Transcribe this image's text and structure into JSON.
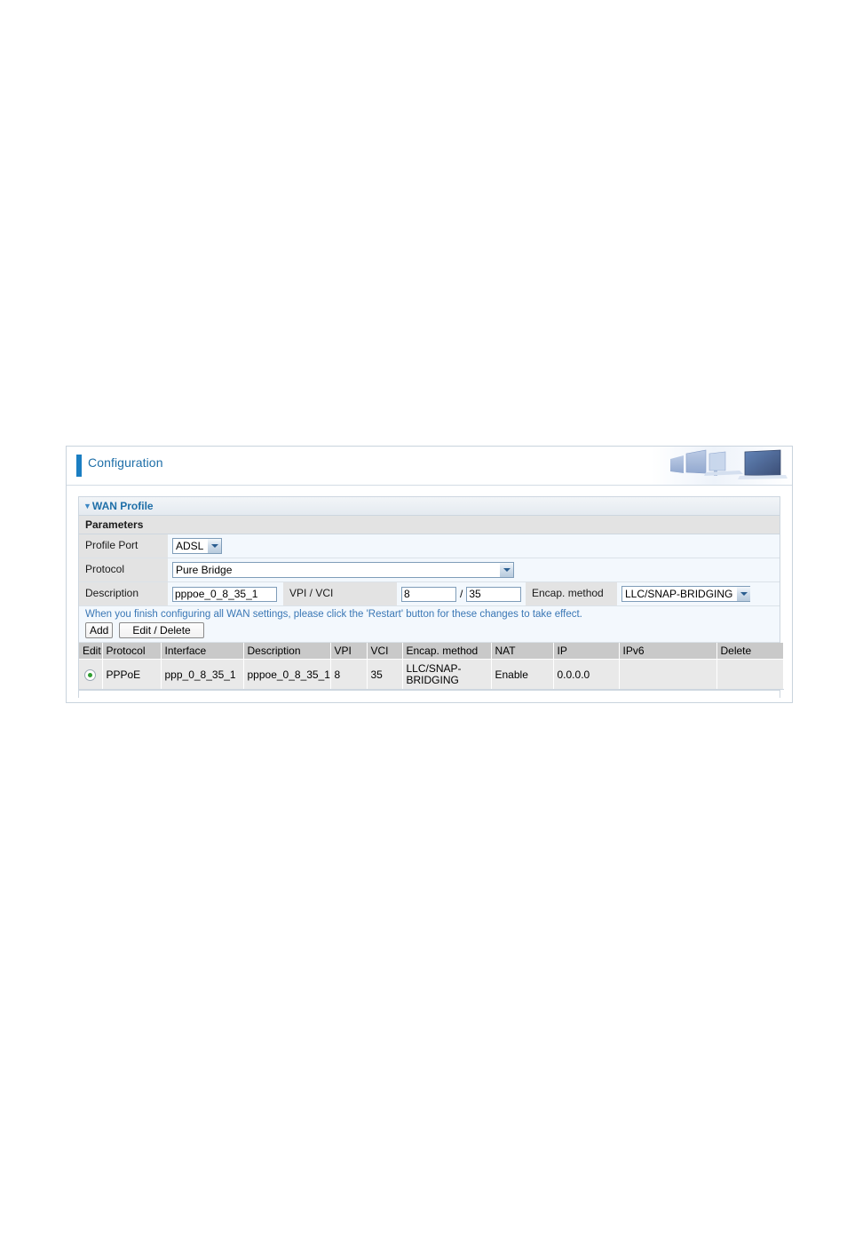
{
  "header": {
    "title": "Configuration",
    "banner_icon": "office-monitors-banner"
  },
  "section": {
    "title": "WAN Profile",
    "collapse_icon": "triangle-down-icon",
    "subtitle": "Parameters"
  },
  "form": {
    "profile_port": {
      "label": "Profile Port",
      "value": "ADSL",
      "options": [
        "ADSL"
      ]
    },
    "protocol": {
      "label": "Protocol",
      "value": "Pure Bridge",
      "options": [
        "Pure Bridge"
      ]
    },
    "description": {
      "label": "Description",
      "value": "pppoe_0_8_35_1"
    },
    "vpi_vci": {
      "label": "VPI / VCI",
      "vpi": "8",
      "separator": "/",
      "vci": "35"
    },
    "encap_method": {
      "label": "Encap. method",
      "value": "LLC/SNAP-BRIDGING",
      "options": [
        "LLC/SNAP-BRIDGING"
      ]
    }
  },
  "notice": "When you finish configuring all WAN settings, please click the 'Restart' button for these changes to take effect.",
  "buttons": {
    "add": "Add",
    "edit_delete": "Edit / Delete"
  },
  "table": {
    "columns": [
      "Edit",
      "Protocol",
      "Interface",
      "Description",
      "VPI",
      "VCI",
      "Encap. method",
      "NAT",
      "IP",
      "IPv6",
      "Delete"
    ],
    "rows": [
      {
        "edit": "radio-selected",
        "protocol": "PPPoE",
        "interface": "ppp_0_8_35_1",
        "description": "pppoe_0_8_35_1",
        "vpi": "8",
        "vci": "35",
        "encap_method": "LLC/SNAP-BRIDGING",
        "nat": "Enable",
        "ip": "0.0.0.0",
        "ipv6": "",
        "delete": ""
      }
    ]
  },
  "colors": {
    "accent_blue": "#1f6fa8",
    "bar_blue": "#1b7ec2",
    "note_blue": "#3a77b5",
    "radio_green": "#2f9e32",
    "header_gray": "#c9c9c9",
    "row_gray": "#e9e9e9",
    "label_gray": "#e3e3e3",
    "field_bg": "#f3f8fd"
  }
}
